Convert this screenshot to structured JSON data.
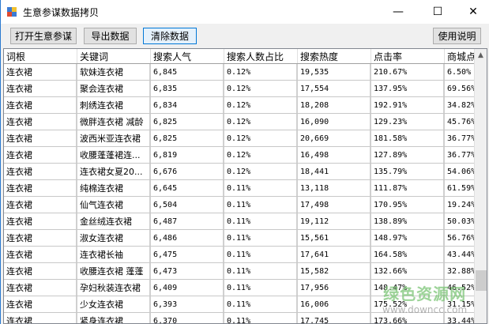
{
  "window": {
    "title": "生意参谋数据拷贝",
    "minimize": "—",
    "maximize": "☐",
    "close": "✕"
  },
  "toolbar": {
    "open": "打开生意参谋",
    "export": "导出数据",
    "clear": "清除数据",
    "help": "使用说明"
  },
  "table": {
    "headers": [
      "词根",
      "关键词",
      "搜索人气",
      "搜索人数占比",
      "搜索热度",
      "点击率",
      "商城点"
    ],
    "rows": [
      [
        "连衣裙",
        "软妹连衣裙",
        "6,845",
        "0.12%",
        "19,535",
        "210.67%",
        "6.50%"
      ],
      [
        "连衣裙",
        "聚会连衣裙",
        "6,835",
        "0.12%",
        "17,554",
        "137.95%",
        "69.56%"
      ],
      [
        "连衣裙",
        "刺绣连衣裙",
        "6,834",
        "0.12%",
        "18,208",
        "192.91%",
        "34.82%"
      ],
      [
        "连衣裙",
        "微胖连衣裙 减龄",
        "6,825",
        "0.12%",
        "16,090",
        "129.23%",
        "45.76%"
      ],
      [
        "连衣裙",
        "波西米亚连衣裙",
        "6,825",
        "0.12%",
        "20,669",
        "181.58%",
        "36.77%"
      ],
      [
        "连衣裙",
        "收腰蓬蓬裙连...",
        "6,819",
        "0.12%",
        "16,498",
        "127.89%",
        "36.77%"
      ],
      [
        "连衣裙",
        "连衣裙女夏20...",
        "6,676",
        "0.12%",
        "18,441",
        "135.79%",
        "54.06%"
      ],
      [
        "连衣裙",
        "纯棉连衣裙",
        "6,645",
        "0.11%",
        "13,118",
        "111.87%",
        "61.59%"
      ],
      [
        "连衣裙",
        "仙气连衣裙",
        "6,504",
        "0.11%",
        "17,498",
        "170.95%",
        "19.24%"
      ],
      [
        "连衣裙",
        "金丝绒连衣裙",
        "6,487",
        "0.11%",
        "19,112",
        "138.89%",
        "50.03%"
      ],
      [
        "连衣裙",
        "淑女连衣裙",
        "6,486",
        "0.11%",
        "15,561",
        "148.97%",
        "56.76%"
      ],
      [
        "连衣裙",
        "连衣裙长袖",
        "6,475",
        "0.11%",
        "17,641",
        "164.58%",
        "43.44%"
      ],
      [
        "连衣裙",
        "收腰连衣裙 蓬蓬",
        "6,473",
        "0.11%",
        "15,582",
        "132.66%",
        "32.88%"
      ],
      [
        "连衣裙",
        "孕妇秋装连衣裙",
        "6,409",
        "0.11%",
        "17,956",
        "148.47%",
        "46.52%"
      ],
      [
        "连衣裙",
        "少女连衣裙",
        "6,393",
        "0.11%",
        "16,006",
        "175.52%",
        "31.15%"
      ],
      [
        "连衣裙",
        "紧身连衣裙",
        "6,370",
        "0.11%",
        "17,745",
        "173.66%",
        "33.44%"
      ]
    ]
  },
  "watermark": {
    "line1": "绿色资源网",
    "line2": "www.downcc.com"
  }
}
